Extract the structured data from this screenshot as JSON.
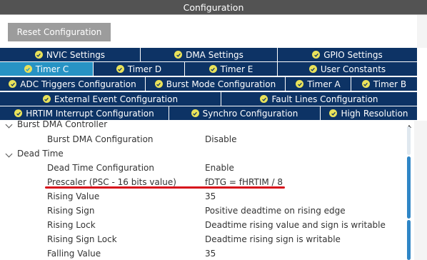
{
  "window": {
    "title": "Configuration"
  },
  "toolbar": {
    "reset_label": "Reset Configuration"
  },
  "tabs": {
    "row1": [
      {
        "label": "NVIC Settings"
      },
      {
        "label": "DMA Settings"
      },
      {
        "label": "GPIO Settings"
      }
    ],
    "row2": [
      {
        "label": "Timer C"
      },
      {
        "label": "Timer D"
      },
      {
        "label": "Timer E"
      },
      {
        "label": "User Constants"
      }
    ],
    "row3": [
      {
        "label": "ADC Triggers Configuration"
      },
      {
        "label": "Burst Mode Configuration"
      },
      {
        "label": "Timer A"
      },
      {
        "label": "Timer B"
      }
    ],
    "row4": [
      {
        "label": "External Event Configuration"
      },
      {
        "label": "Fault Lines Configuration"
      }
    ],
    "row5": [
      {
        "label": "HRTIM Interrupt Configuration"
      },
      {
        "label": "Synchro Configuration"
      },
      {
        "label": "High Resolution"
      }
    ]
  },
  "tree": {
    "burst_dma_group": "Burst DMA Controller",
    "burst_dma_config": {
      "label": "Burst DMA Configuration",
      "value": "Disable"
    },
    "dead_time_group": "Dead Time",
    "props": [
      {
        "label": "Dead Time Configuration",
        "value": "Enable"
      },
      {
        "label": "Prescaler (PSC - 16 bits value)",
        "value": "fDTG = fHRTIM / 8"
      },
      {
        "label": "Rising Value",
        "value": "35"
      },
      {
        "label": "Rising Sign",
        "value": "Positive deadtime on rising edge"
      },
      {
        "label": "Rising Lock",
        "value": "Deadtime rising value and sign is writable"
      },
      {
        "label": "Rising Sign Lock",
        "value": "Deadtime rising sign is writable"
      },
      {
        "label": "Falling Value",
        "value": "35"
      }
    ]
  },
  "colors": {
    "tab_bg": "#0d3365",
    "tab_active": "#2793c4",
    "check_fill": "#e9e25a",
    "annotation_underline": "#d60f1b",
    "scrollbar_thumb": "#2f86c6"
  }
}
